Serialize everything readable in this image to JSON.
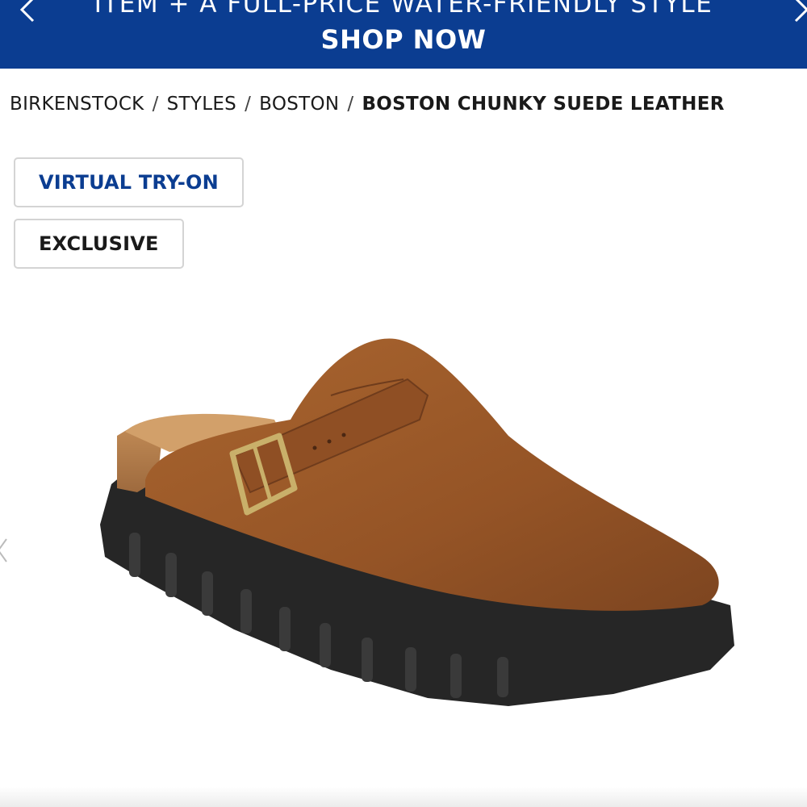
{
  "promo_banner": {
    "line1": "ITEM + A FULL-PRICE WATER-FRIENDLY STYLE",
    "cta": "SHOP NOW",
    "background_color": "#0b3d91",
    "prev_icon": "chevron-left-icon",
    "next_icon": "chevron-right-icon"
  },
  "breadcrumb": {
    "items": [
      "BIRKENSTOCK",
      "STYLES",
      "BOSTON"
    ],
    "separator": "/",
    "current": "BOSTON CHUNKY SUEDE LEATHER"
  },
  "badges": {
    "virtual_try_on": "VIRTUAL TRY-ON",
    "exclusive": "EXCLUSIVE"
  },
  "product": {
    "image_icon": "suede-clog-product-image",
    "colors": {
      "suede": "#9b5a2a",
      "sole": "#262626",
      "footbed": "#c9925a",
      "buckle": "#c9b06a"
    }
  },
  "gallery": {
    "prev_icon": "chevron-left-icon"
  }
}
